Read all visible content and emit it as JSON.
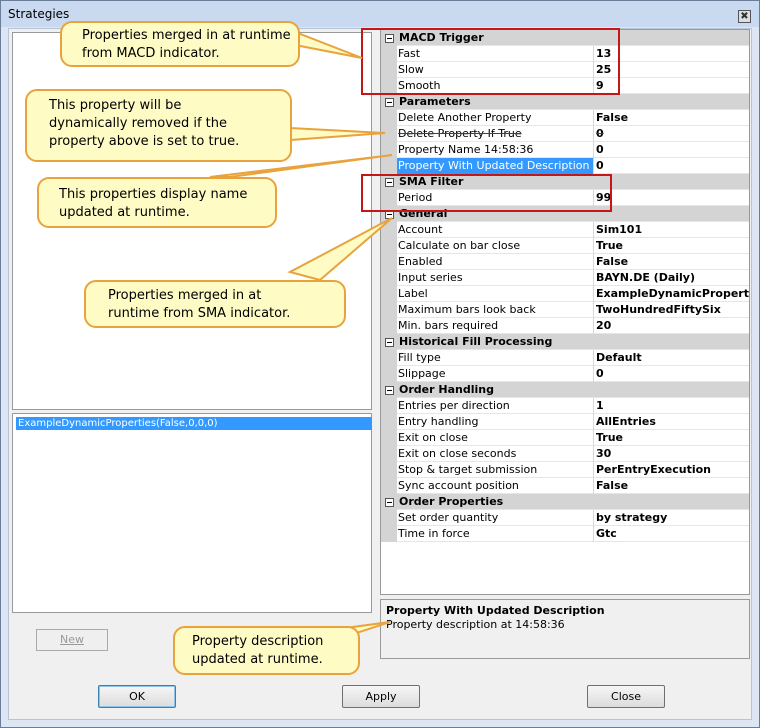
{
  "window": {
    "title": "Strategies",
    "close_glyph": "✖"
  },
  "strategy_list": {
    "selected_item": "ExampleDynamicProperties(False,0,0,0)"
  },
  "buttons": {
    "new": "New",
    "ok": "OK",
    "apply": "Apply",
    "close": "Close"
  },
  "property_grid": {
    "rows": [
      {
        "type": "category",
        "label": "MACD Trigger"
      },
      {
        "type": "prop",
        "name": "Fast",
        "value": "13"
      },
      {
        "type": "prop",
        "name": "Slow",
        "value": "25"
      },
      {
        "type": "prop",
        "name": "Smooth",
        "value": "9"
      },
      {
        "type": "category",
        "label": "Parameters"
      },
      {
        "type": "prop",
        "name": "Delete Another Property",
        "value": "False"
      },
      {
        "type": "prop",
        "name": "Delete Property If True",
        "value": "0",
        "strike": true
      },
      {
        "type": "prop",
        "name": "Property Name 14:58:36",
        "value": "0"
      },
      {
        "type": "prop",
        "name": "Property With Updated Description",
        "value": "0",
        "selected": true
      },
      {
        "type": "category",
        "label": "SMA Filter"
      },
      {
        "type": "prop",
        "name": "Period",
        "value": "99"
      },
      {
        "type": "category",
        "label": "General"
      },
      {
        "type": "prop",
        "name": "Account",
        "value": "Sim101"
      },
      {
        "type": "prop",
        "name": "Calculate on bar close",
        "value": "True"
      },
      {
        "type": "prop",
        "name": "Enabled",
        "value": "False"
      },
      {
        "type": "prop",
        "name": "Input series",
        "value": "BAYN.DE (Daily)"
      },
      {
        "type": "prop",
        "name": "Label",
        "value": "ExampleDynamicProperties"
      },
      {
        "type": "prop",
        "name": "Maximum bars look back",
        "value": "TwoHundredFiftySix"
      },
      {
        "type": "prop",
        "name": "Min. bars required",
        "value": "20"
      },
      {
        "type": "category",
        "label": "Historical Fill Processing"
      },
      {
        "type": "prop",
        "name": "Fill type",
        "value": "Default"
      },
      {
        "type": "prop",
        "name": "Slippage",
        "value": "0"
      },
      {
        "type": "category",
        "label": "Order Handling"
      },
      {
        "type": "prop",
        "name": "Entries per direction",
        "value": "1"
      },
      {
        "type": "prop",
        "name": "Entry handling",
        "value": "AllEntries"
      },
      {
        "type": "prop",
        "name": "Exit on close",
        "value": "True"
      },
      {
        "type": "prop",
        "name": "Exit on close seconds",
        "value": "30"
      },
      {
        "type": "prop",
        "name": "Stop & target submission",
        "value": "PerEntryExecution"
      },
      {
        "type": "prop",
        "name": "Sync account position",
        "value": "False"
      },
      {
        "type": "category",
        "label": "Order Properties"
      },
      {
        "type": "prop",
        "name": "Set order quantity",
        "value": "by strategy"
      },
      {
        "type": "prop",
        "name": "Time in force",
        "value": "Gtc"
      }
    ]
  },
  "description": {
    "title": "Property With Updated Description",
    "text": "Property description at 14:58:36"
  },
  "callouts": {
    "macd": "Properties merged in at runtime from MACD indicator.",
    "removed": "This property will be dynamically removed if the property above is set to true.",
    "display_name": "This properties display name updated at runtime.",
    "sma": "Properties merged in at runtime from SMA indicator.",
    "description": "Property description updated at runtime."
  },
  "colors": {
    "callout_fill": "#fffbc4",
    "callout_border": "#e8a33c",
    "highlight_box": "#c31818",
    "selection": "#3399ff"
  }
}
